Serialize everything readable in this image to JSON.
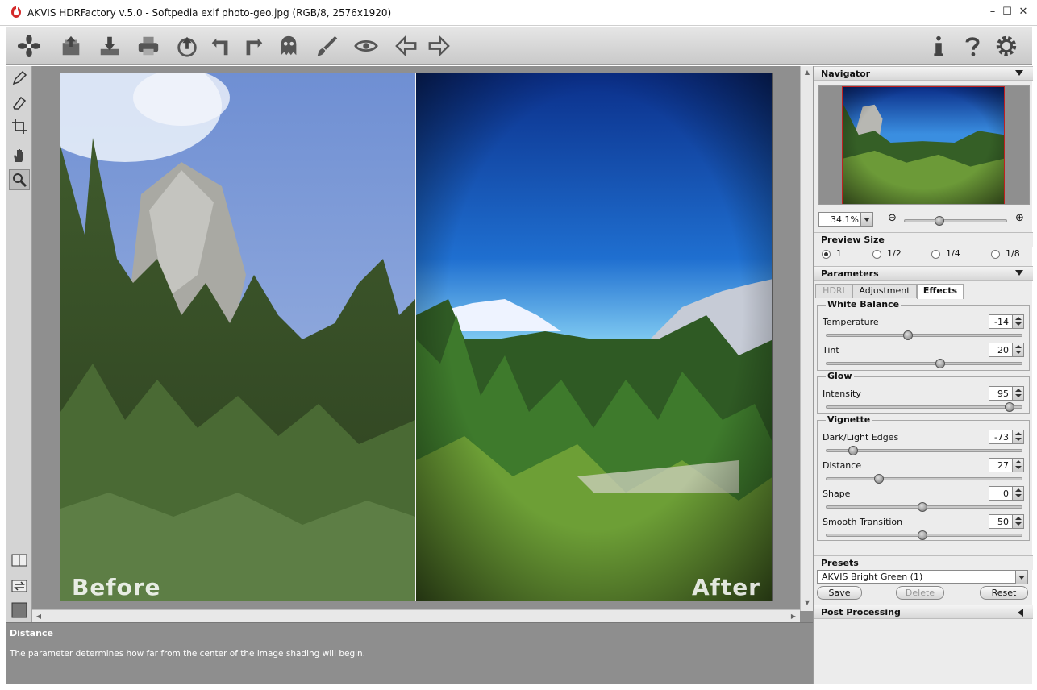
{
  "window": {
    "title": "AKVIS HDRFactory v.5.0 - Softpedia exif photo-geo.jpg (RGB/8, 2576x1920)",
    "minimize": "–",
    "maximize": "☐",
    "close": "✕"
  },
  "toolbar": {
    "items": [
      "logo-icon",
      "open-icon",
      "save-icon",
      "print-icon",
      "share-icon",
      "undo-icon",
      "redo-icon",
      "ghost-icon",
      "brush-icon",
      "eye-icon",
      "back-icon",
      "forward-icon",
      "info-icon",
      "help-icon",
      "settings-icon"
    ]
  },
  "canvas": {
    "before_label": "Before",
    "after_label": "After"
  },
  "hint": {
    "title": "Distance",
    "text": "The parameter determines how far from the center of the image shading will begin."
  },
  "navigator": {
    "title": "Navigator",
    "zoom": "34.1%",
    "zoom_minus": "⊖",
    "zoom_plus": "⊕"
  },
  "preview_size": {
    "title": "Preview Size",
    "options": [
      "1",
      "1/2",
      "1/4",
      "1/8"
    ],
    "selected": "1"
  },
  "parameters": {
    "title": "Parameters",
    "tabs": [
      "HDRI",
      "Adjustment",
      "Effects"
    ],
    "active_tab": "Effects",
    "white_balance": {
      "title": "White Balance",
      "temperature_label": "Temperature",
      "temperature": "-14",
      "tint_label": "Tint",
      "tint": "20"
    },
    "glow": {
      "title": "Glow",
      "intensity_label": "Intensity",
      "intensity": "95"
    },
    "vignette": {
      "title": "Vignette",
      "edges_label": "Dark/Light Edges",
      "edges": "-73",
      "distance_label": "Distance",
      "distance": "27",
      "shape_label": "Shape",
      "shape": "0",
      "smooth_label": "Smooth Transition",
      "smooth": "50"
    }
  },
  "presets": {
    "title": "Presets",
    "selected": "AKVIS Bright Green (1)",
    "save": "Save",
    "delete": "Delete",
    "reset": "Reset"
  },
  "post_processing": {
    "title": "Post Processing"
  }
}
